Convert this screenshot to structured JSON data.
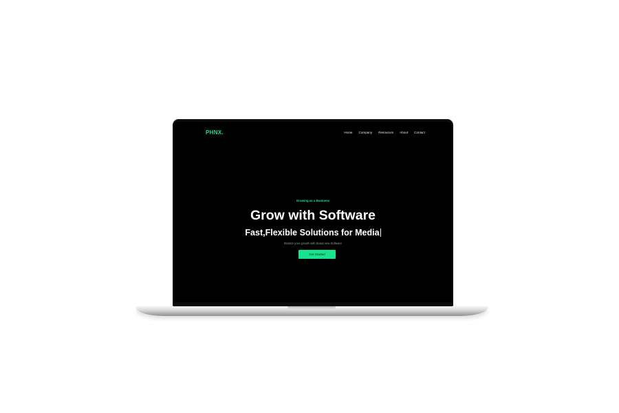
{
  "site": {
    "logo": "PHNX.",
    "nav": [
      "Home",
      "Company",
      "Resources",
      "About",
      "Contact"
    ]
  },
  "hero": {
    "eyebrow": "Growing as a Business",
    "headline": "Grow with Software",
    "subheadline": "Fast,Flexible Solutions for Media",
    "description": "Monitor your growth with brand new Software",
    "cta_label": "Get Started"
  },
  "colors": {
    "accent": "#19e38f",
    "background": "#000000",
    "text": "#ffffff"
  }
}
